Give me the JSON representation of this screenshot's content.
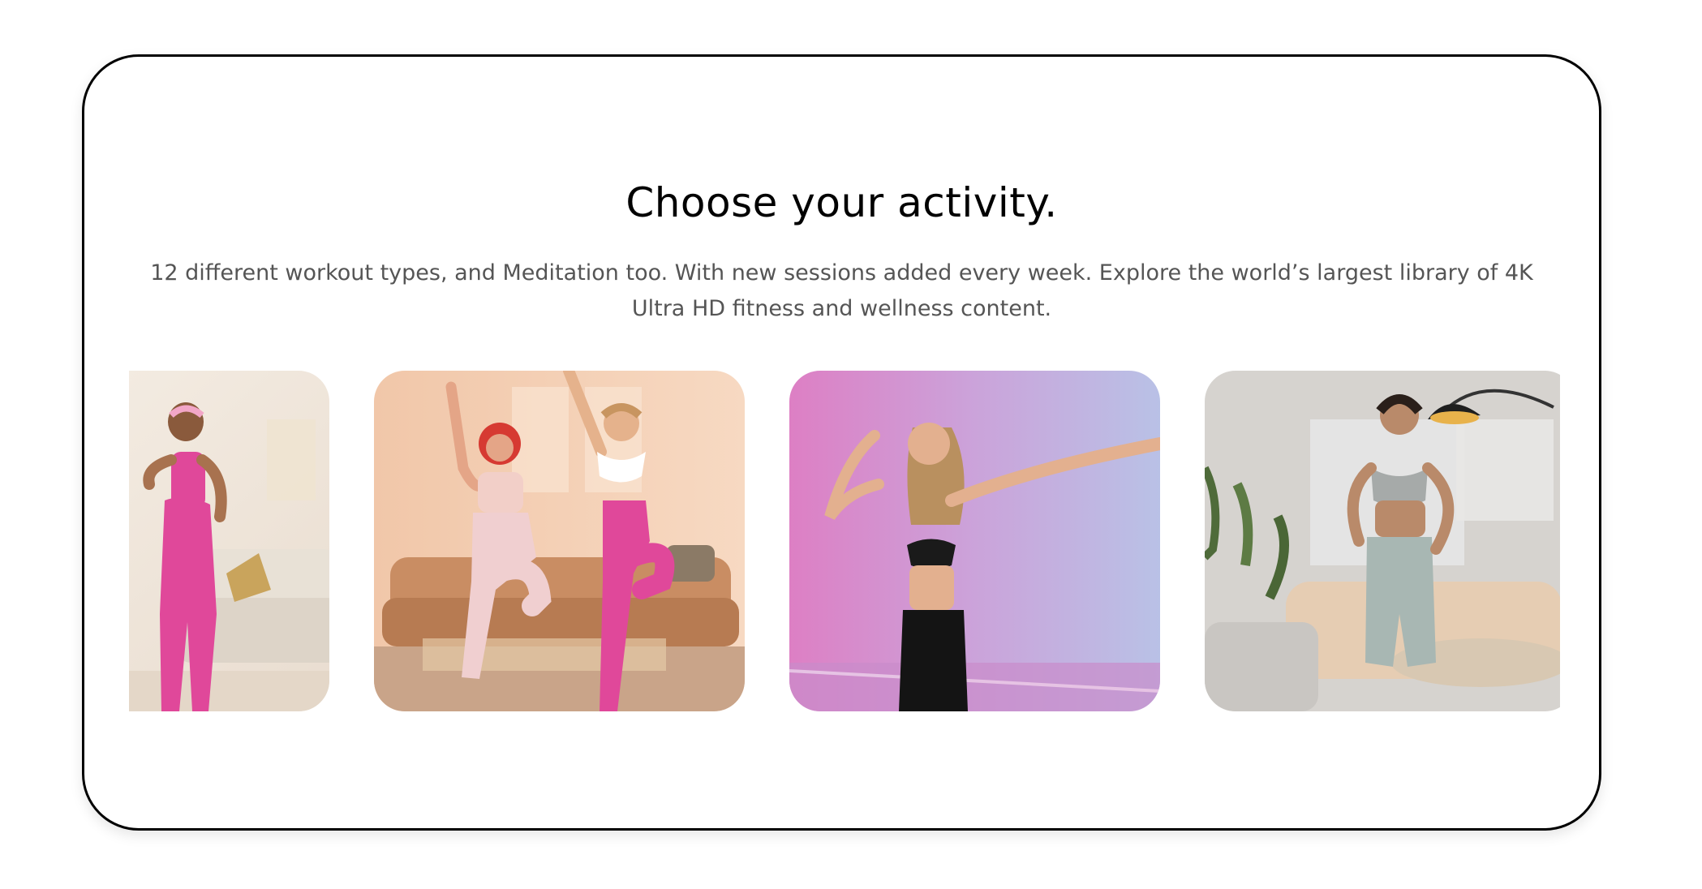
{
  "section": {
    "title": "Choose your activity.",
    "description": "12 different workout types, and Meditation too. With new sessions added every week. Explore the world’s largest library of 4K Ultra HD fitness and wellness content."
  },
  "carousel": {
    "tiles": [
      {
        "icon": "woman-cheering-photo",
        "accent": "#e0489a"
      },
      {
        "icon": "two-women-knee-raise-photo",
        "accent": "#e0489a"
      },
      {
        "icon": "woman-dancing-photo",
        "accent": "#d67fbf"
      },
      {
        "icon": "woman-standing-living-room-photo",
        "accent": "#a8b7b3"
      }
    ]
  }
}
